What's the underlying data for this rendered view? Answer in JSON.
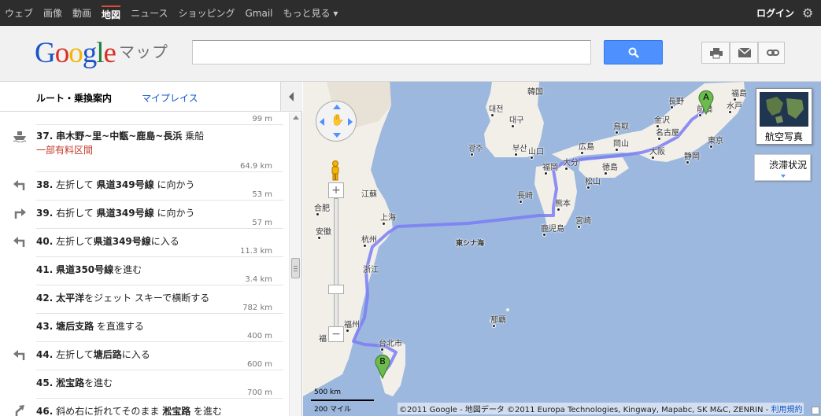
{
  "topbar": {
    "nav": [
      "ウェブ",
      "画像",
      "動画",
      "地図",
      "ニュース",
      "ショッピング",
      "Gmail",
      "もっと見る ▾"
    ],
    "active_index": 3,
    "login": "ログイン",
    "gear_icon": "gear-icon"
  },
  "header": {
    "logo": "Google",
    "maps_label": "マップ",
    "search_value": "",
    "buttons": [
      "print-icon",
      "mail-icon",
      "link-icon"
    ]
  },
  "sidebar": {
    "tab_route": "ルート・乗換案内",
    "tab_myplaces": "マイプレイス",
    "steps": [
      {
        "num": "37.",
        "text_parts": [
          {
            "t": "串木野~里~中甑~鹿島~長浜",
            "b": true
          },
          {
            "t": " 乗船",
            "b": false
          }
        ],
        "sub": "一部有料区間",
        "icon": "ferry-icon",
        "dist": "99 m"
      },
      {
        "num": "38.",
        "text_parts": [
          {
            "t": "左折して ",
            "b": false
          },
          {
            "t": "県道349号線",
            "b": true
          },
          {
            "t": " に向かう",
            "b": false
          }
        ],
        "icon": "turn-left-icon",
        "dist": "64.9 km"
      },
      {
        "num": "39.",
        "text_parts": [
          {
            "t": "右折して ",
            "b": false
          },
          {
            "t": "県道349号線",
            "b": true
          },
          {
            "t": " に向かう",
            "b": false
          }
        ],
        "icon": "turn-right-icon",
        "dist": "53 m"
      },
      {
        "num": "40.",
        "text_parts": [
          {
            "t": "左折して",
            "b": false
          },
          {
            "t": "県道349号線",
            "b": true
          },
          {
            "t": "に入る",
            "b": false
          }
        ],
        "icon": "turn-left-icon",
        "dist": "57 m"
      },
      {
        "num": "41.",
        "text_parts": [
          {
            "t": "県道350号線",
            "b": true
          },
          {
            "t": "を進む",
            "b": false
          }
        ],
        "icon": "",
        "dist": "11.3 km"
      },
      {
        "num": "42.",
        "text_parts": [
          {
            "t": "太平洋",
            "b": true
          },
          {
            "t": "をジェット スキーで横断する",
            "b": false
          }
        ],
        "icon": "",
        "dist": "3.4 km"
      },
      {
        "num": "43.",
        "text_parts": [
          {
            "t": "塘后支路",
            "b": true
          },
          {
            "t": " を直進する",
            "b": false
          }
        ],
        "icon": "",
        "dist": "782 km"
      },
      {
        "num": "44.",
        "text_parts": [
          {
            "t": "左折して",
            "b": false
          },
          {
            "t": "塘后路",
            "b": true
          },
          {
            "t": "に入る",
            "b": false
          }
        ],
        "icon": "turn-left-icon",
        "dist": "400 m"
      },
      {
        "num": "45.",
        "text_parts": [
          {
            "t": "淞宝路",
            "b": true
          },
          {
            "t": "を進む",
            "b": false
          }
        ],
        "icon": "",
        "dist": "600 m"
      },
      {
        "num": "46.",
        "text_parts": [
          {
            "t": "斜め右に折れてそのまま ",
            "b": false
          },
          {
            "t": "淞宝路",
            "b": true
          },
          {
            "t": " を進む",
            "b": false
          }
        ],
        "icon": "slight-right-icon",
        "dist": "700 m"
      }
    ],
    "bottom_dist": "700 m"
  },
  "map": {
    "labels": [
      "韓国",
      "대전",
      "대구",
      "광주",
      "부산",
      "山口",
      "広島",
      "鳥取",
      "岡山",
      "大阪",
      "名古屋",
      "長野",
      "前橋",
      "福島",
      "水戸",
      "東京",
      "静岡",
      "金沢",
      "福岡",
      "大分",
      "松山",
      "徳島",
      "長崎",
      "熊本",
      "宮崎",
      "鹿児島",
      "東シナ海",
      "江蘇",
      "合肥",
      "安徽",
      "上海",
      "杭州",
      "浙江",
      "福州",
      "福",
      "台北市",
      "那覇"
    ],
    "markers": [
      "A",
      "B"
    ],
    "satellite_label": "航空写真",
    "traffic_label": "渋滞状況",
    "scale_km": "500 km",
    "scale_mi": "200 マイル",
    "copyright": "©2011 Google - 地図データ ©2011 Europa Technologies, Kingway, Mapabc, SK M&C, ZENRIN - ",
    "terms": "利用規約",
    "route_color": "#7b7cf5"
  }
}
